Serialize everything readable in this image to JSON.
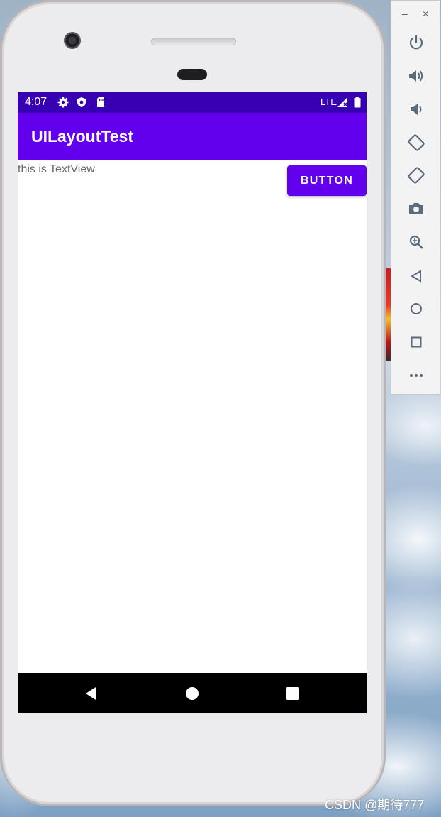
{
  "status_bar": {
    "time": "4:07",
    "network": "LTE",
    "icons": [
      "settings-icon",
      "shield-icon",
      "sd-card-icon",
      "signal-icon",
      "battery-icon"
    ]
  },
  "app_bar": {
    "title": "UILayoutTest"
  },
  "content": {
    "text_view": "this is TextView",
    "button_label": "BUTTON"
  },
  "nav_bar": {
    "icons": [
      "back-icon",
      "home-icon",
      "recents-icon"
    ]
  },
  "emulator_toolbar": {
    "window_controls": {
      "minimize": "–",
      "close": "×"
    },
    "icons": [
      "power-icon",
      "volume-up-icon",
      "volume-down-icon",
      "rotate-left-icon",
      "rotate-right-icon",
      "screenshot-icon",
      "zoom-icon",
      "back-icon",
      "home-icon",
      "overview-icon",
      "more-icon"
    ]
  },
  "watermark": "CSDN @期待777",
  "colors": {
    "status_bar": "#3700b3",
    "primary": "#6200ee",
    "nav_bar": "#000000"
  }
}
